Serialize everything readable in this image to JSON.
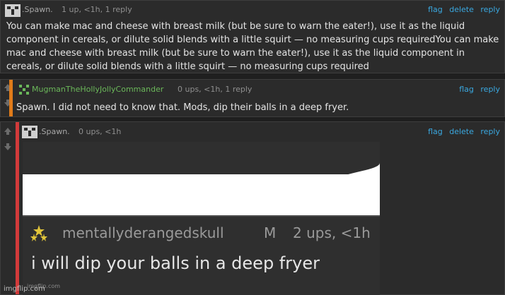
{
  "comments": [
    {
      "username": ".Spawn.",
      "meta": "1 up, <1h, 1 reply",
      "actions": [
        "flag",
        "delete",
        "reply"
      ],
      "text": "You can make mac and cheese with breast milk (but be sure to warn the eater!), use it as the liquid component in cereals, or dilute solid blends with a little squirt — no measuring cups requiredYou can make mac and cheese with breast milk (but be sure to warn the eater!), use it as the liquid component in cereals, or dilute solid blends with a little squirt — no measuring cups required"
    },
    {
      "username": "MugmanTheHollyJollyCommander",
      "meta": "0 ups, <1h, 1 reply",
      "actions": [
        "flag",
        "reply"
      ],
      "text": "Spawn. I did not need to know that. Mods, dip their balls in a deep fryer."
    },
    {
      "username": ".Spawn.",
      "meta": "0 ups, <1h",
      "actions": [
        "flag",
        "delete",
        "reply"
      ],
      "image": {
        "username": "mentallyderangedskull",
        "badge": "M",
        "meta": "2 ups, <1h",
        "text": "i will dip your balls in a deep fryer",
        "watermark": "imgflip.com"
      }
    }
  ],
  "footer": {
    "watermark": "imgflip.com"
  },
  "colors": {
    "accent": "#3aa8e0",
    "reply_bar_green": "#e07b1a",
    "reply_bar_red": "#d23a3a",
    "username_green": "#6bb85a"
  }
}
